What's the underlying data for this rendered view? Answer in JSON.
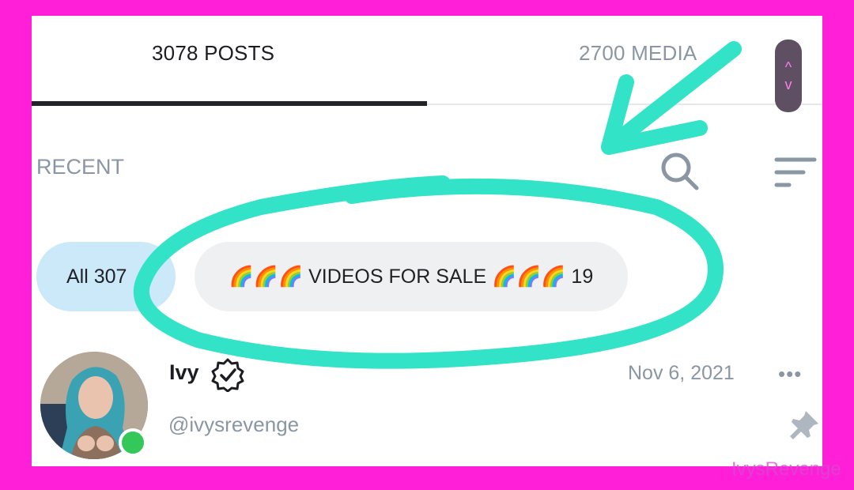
{
  "tabs": [
    {
      "label": "3078 POSTS",
      "active": true
    },
    {
      "label": "2700 MEDIA",
      "active": false
    }
  ],
  "feed": {
    "sort_label": "RECENT",
    "filters": [
      {
        "label": "All 307",
        "selected": true
      },
      {
        "label": "🌈🌈🌈 VIDEOS FOR SALE 🌈🌈🌈 19",
        "selected": false
      }
    ]
  },
  "post": {
    "author_name": "Ivy",
    "author_handle": "@ivysrevenge",
    "date": "Nov 6, 2021",
    "more_label": "•••",
    "online": true,
    "pinned": true
  },
  "scroll_arrows": {
    "up": "^",
    "down": "v"
  },
  "watermark": "IvysRevenge",
  "icons": {
    "search": "search-icon",
    "sort": "sort-icon",
    "verified": "verified-badge-icon",
    "pin": "pin-icon"
  },
  "colors": {
    "border": "#ff1fd8",
    "annotation": "#32e3c7",
    "active_chip": "#cbe9f8",
    "inactive_chip": "#eef0f1",
    "muted_text": "#8a96a3",
    "online": "#34c759"
  }
}
